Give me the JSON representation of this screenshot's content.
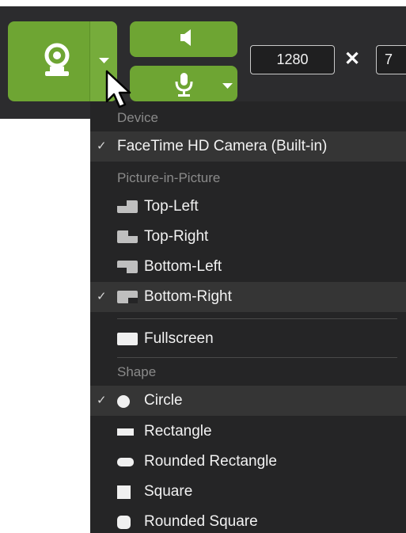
{
  "toolbar": {
    "width_value": "1280",
    "times_symbol": "✕",
    "height_value": "7"
  },
  "menu": {
    "device_header": "Device",
    "device_item": "FaceTime HD Camera (Built-in)",
    "pip_header": "Picture-in-Picture",
    "pip_items": [
      "Top-Left",
      "Top-Right",
      "Bottom-Left",
      "Bottom-Right"
    ],
    "fullscreen": "Fullscreen",
    "shape_header": "Shape",
    "shape_items": [
      "Circle",
      "Rectangle",
      "Rounded Rectangle",
      "Square",
      "Rounded Square"
    ],
    "check": "✓"
  },
  "colors": {
    "accent_green": "#6ea533",
    "toolbar_bg": "#2c2c2e",
    "menu_bg": "#252526",
    "selected_bg": "#353535"
  },
  "icons": [
    "webcam-icon",
    "dropdown-arrow-icon",
    "speaker-icon",
    "microphone-icon",
    "pip-layout-icon",
    "fullscreen-icon",
    "shape-icon",
    "mouse-cursor-icon"
  ]
}
